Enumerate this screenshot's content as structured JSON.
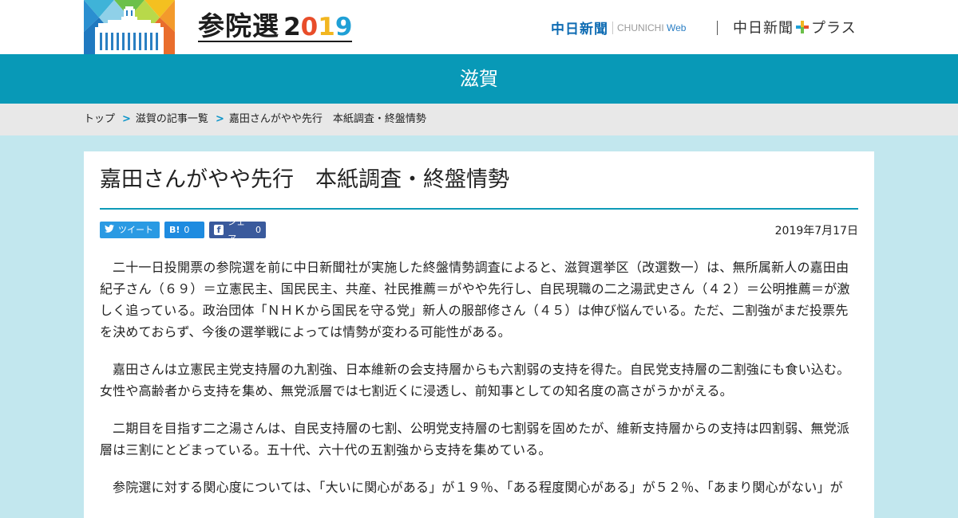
{
  "header": {
    "site_title": "参院選",
    "site_year": "2019",
    "brand_chunichi": "中日新聞",
    "brand_web_prefix": "CHUNICHI",
    "brand_web_suffix": "Web",
    "brand_plus_name": "中日新聞",
    "brand_plus_suffix": "プラス"
  },
  "region": "滋賀",
  "breadcrumb": {
    "items": [
      "トップ",
      "滋賀の記事一覧",
      "嘉田さんがやや先行　本紙調査・終盤情勢"
    ],
    "separator": ">"
  },
  "article": {
    "headline": "嘉田さんがやや先行　本紙調査・終盤情勢",
    "date": "2019年7月17日",
    "share": {
      "tweet_label": "ツイート",
      "hatena_icon": "B!",
      "hatena_count": "0",
      "facebook_label": "シェア",
      "facebook_count": "0"
    },
    "paragraphs": [
      "二十一日投開票の参院選を前に中日新聞社が実施した終盤情勢調査によると、滋賀選挙区（改選数一）は、無所属新人の嘉田由紀子さん（６９）＝立憲民主、国民民主、共産、社民推薦＝がやや先行し、自民現職の二之湯武史さん（４２）＝公明推薦＝が激しく追っている。政治団体「ＮＨＫから国民を守る党」新人の服部修さん（４５）は伸び悩んでいる。ただ、二割強がまだ投票先を決めておらず、今後の選挙戦によっては情勢が変わる可能性がある。",
      "嘉田さんは立憲民主党支持層の九割強、日本維新の会支持層からも六割弱の支持を得た。自民党支持層の二割強にも食い込む。女性や高齢者から支持を集め、無党派層では七割近くに浸透し、前知事としての知名度の高さがうかがえる。",
      "二期目を目指す二之湯さんは、自民支持層の七割、公明党支持層の七割弱を固めたが、維新支持層からの支持は四割弱、無党派層は三割にとどまっている。五十代、六十代の五割強から支持を集めている。",
      "参院選に対する関心度については、「大いに関心がある」が１９％、「ある程度関心がある」が５２％、「あまり関心がない」が"
    ]
  },
  "colors": {
    "accent": "#0899b7",
    "page_bg": "#c2e7ee",
    "twitter": "#2a9ae3",
    "hatena": "#1e8be0",
    "facebook": "#3a5a9c"
  }
}
